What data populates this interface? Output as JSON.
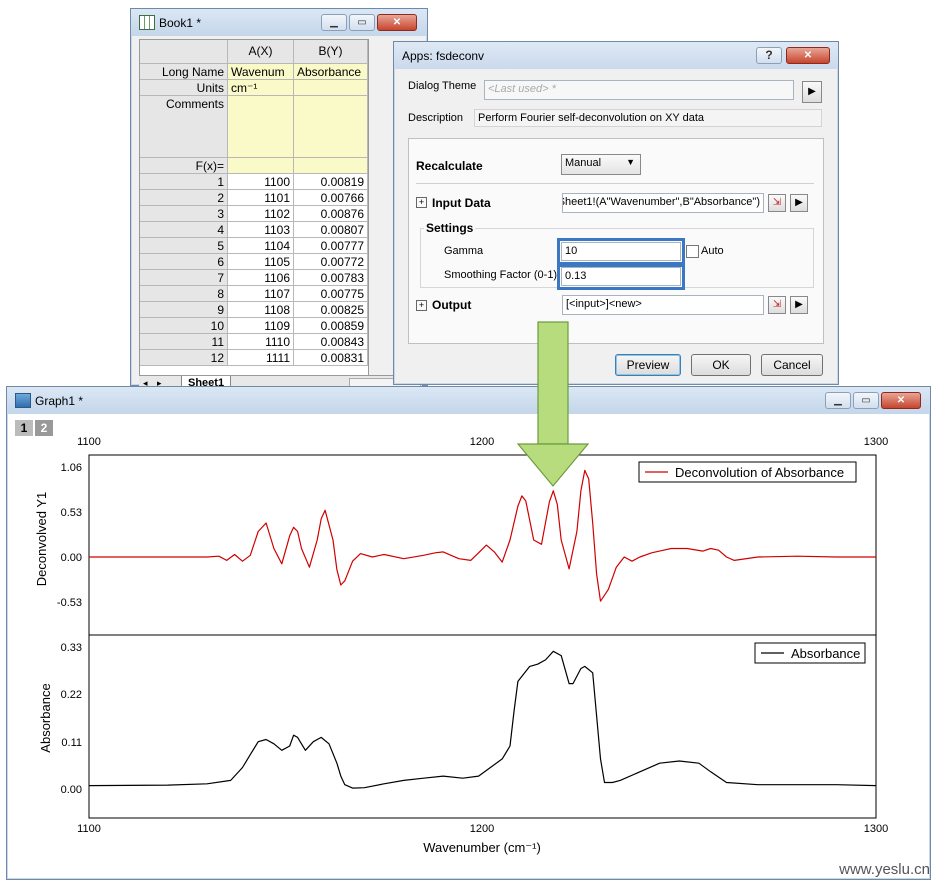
{
  "book": {
    "title": "Book1 *",
    "col_a": "A(X)",
    "col_b": "B(Y)",
    "row_labels": [
      "Long Name",
      "Units",
      "Comments",
      "F(x)="
    ],
    "long_name_a": "Wavenum",
    "long_name_b": "Absorbance",
    "units_a": "cm⁻¹",
    "rows": [
      {
        "n": "1",
        "x": "1100",
        "y": "0.00819"
      },
      {
        "n": "2",
        "x": "1101",
        "y": "0.00766"
      },
      {
        "n": "3",
        "x": "1102",
        "y": "0.00876"
      },
      {
        "n": "4",
        "x": "1103",
        "y": "0.00807"
      },
      {
        "n": "5",
        "x": "1104",
        "y": "0.00777"
      },
      {
        "n": "6",
        "x": "1105",
        "y": "0.00772"
      },
      {
        "n": "7",
        "x": "1106",
        "y": "0.00783"
      },
      {
        "n": "8",
        "x": "1107",
        "y": "0.00775"
      },
      {
        "n": "9",
        "x": "1108",
        "y": "0.00825"
      },
      {
        "n": "10",
        "x": "1109",
        "y": "0.00859"
      },
      {
        "n": "11",
        "x": "1110",
        "y": "0.00843"
      },
      {
        "n": "12",
        "x": "1111",
        "y": "0.00831"
      }
    ],
    "sheet_tab": "Sheet1"
  },
  "dialog": {
    "title": "Apps: fsdeconv",
    "help": "?",
    "theme_label": "Dialog Theme",
    "theme_value": "<Last used> *",
    "desc_label": "Description",
    "desc_value": "Perform Fourier self-deconvolution on XY data",
    "recalc_label": "Recalculate",
    "recalc_value": "Manual",
    "input_label": "Input Data",
    "input_value": "Sheet1!(A\"Wavenumber\",B\"Absorbance\")",
    "settings_label": "Settings",
    "gamma_label": "Gamma",
    "gamma_value": "10",
    "auto_label": "Auto",
    "smooth_label": "Smoothing Factor (0-1)",
    "smooth_value": "0.13",
    "output_label": "Output",
    "output_value": "[<input>]<new>",
    "preview": "Preview",
    "ok": "OK",
    "cancel": "Cancel"
  },
  "graph": {
    "title": "Graph1 *",
    "layer_tabs": [
      "1",
      "2"
    ],
    "xlabel": "Wavenumber (cm⁻¹)",
    "watermark": "www.yeslu.cn"
  },
  "chart_data": [
    {
      "type": "line",
      "ylabel": "Deconvolved Y1",
      "xlim": [
        1100,
        1300
      ],
      "ylim": [
        -0.75,
        1.1
      ],
      "xticks": [
        "1100",
        "1200",
        "1300"
      ],
      "yticks": [
        "1.06",
        "0.53",
        "0.00",
        "-0.53"
      ],
      "series": [
        {
          "name": "Deconvolution of Absorbance",
          "color": "#d00000",
          "x": [
            1100,
            1130,
            1133,
            1135,
            1137,
            1139,
            1141,
            1143,
            1145,
            1147,
            1149,
            1151,
            1152,
            1153,
            1154,
            1156,
            1158,
            1159,
            1160,
            1162,
            1163,
            1164,
            1165,
            1167,
            1169,
            1172,
            1175,
            1180,
            1185,
            1188,
            1190,
            1192,
            1194,
            1197,
            1199,
            1201,
            1203,
            1205,
            1207,
            1209,
            1210,
            1211,
            1213,
            1215,
            1217,
            1218,
            1219,
            1220,
            1222,
            1224,
            1225,
            1226,
            1227,
            1228,
            1229,
            1230,
            1232,
            1234,
            1236,
            1238,
            1240,
            1243,
            1246,
            1248,
            1252,
            1256,
            1258,
            1260,
            1262,
            1264,
            1270,
            1280,
            1290,
            1300
          ],
          "y": [
            0.0,
            0.0,
            0.01,
            -0.04,
            0.03,
            -0.05,
            0.02,
            0.3,
            0.4,
            0.1,
            -0.08,
            0.25,
            0.35,
            0.3,
            0.1,
            -0.12,
            0.2,
            0.45,
            0.55,
            0.2,
            -0.15,
            -0.33,
            -0.28,
            -0.05,
            0.04,
            0.0,
            0.03,
            -0.02,
            0.02,
            0.05,
            0.06,
            0.02,
            -0.02,
            -0.04,
            0.05,
            0.14,
            0.06,
            -0.06,
            0.2,
            0.6,
            0.72,
            0.66,
            0.2,
            0.15,
            0.65,
            0.78,
            0.62,
            0.2,
            -0.14,
            0.3,
            0.78,
            1.02,
            0.92,
            0.4,
            -0.2,
            -0.52,
            -0.38,
            -0.12,
            0.0,
            -0.05,
            0.0,
            0.05,
            0.08,
            0.1,
            0.1,
            0.07,
            0.1,
            0.08,
            0.0,
            -0.04,
            0.0,
            0.01,
            0.0,
            0.0
          ]
        }
      ]
    },
    {
      "type": "line",
      "ylabel": "Absorbance",
      "xlim": [
        1100,
        1300
      ],
      "ylim": [
        -0.01,
        0.34
      ],
      "xticks": [
        "1100",
        "1200",
        "1300"
      ],
      "yticks": [
        "0.33",
        "0.22",
        "0.11",
        "0.00"
      ],
      "series": [
        {
          "name": "Absorbance",
          "color": "#000000",
          "x": [
            1100,
            1120,
            1130,
            1136,
            1139,
            1141,
            1143,
            1145,
            1147,
            1149,
            1151,
            1152,
            1153,
            1155,
            1157,
            1159,
            1161,
            1163,
            1164,
            1165,
            1167,
            1170,
            1175,
            1180,
            1185,
            1190,
            1195,
            1199,
            1202,
            1205,
            1207,
            1208,
            1209,
            1212,
            1214,
            1216,
            1217,
            1218,
            1220,
            1222,
            1223,
            1225,
            1226,
            1228,
            1229,
            1230,
            1231,
            1233,
            1235,
            1240,
            1245,
            1250,
            1255,
            1258,
            1262,
            1270,
            1280,
            1290,
            1300
          ],
          "y": [
            0.008,
            0.009,
            0.012,
            0.02,
            0.05,
            0.08,
            0.11,
            0.115,
            0.105,
            0.09,
            0.1,
            0.125,
            0.12,
            0.09,
            0.11,
            0.12,
            0.105,
            0.06,
            0.03,
            0.01,
            0.002,
            0.003,
            0.012,
            0.02,
            0.025,
            0.03,
            0.025,
            0.03,
            0.05,
            0.07,
            0.1,
            0.18,
            0.25,
            0.285,
            0.29,
            0.3,
            0.31,
            0.32,
            0.31,
            0.245,
            0.245,
            0.28,
            0.285,
            0.27,
            0.17,
            0.07,
            0.015,
            0.015,
            0.02,
            0.04,
            0.06,
            0.065,
            0.06,
            0.04,
            0.015,
            0.01,
            0.01,
            0.01,
            0.008
          ]
        }
      ]
    }
  ]
}
